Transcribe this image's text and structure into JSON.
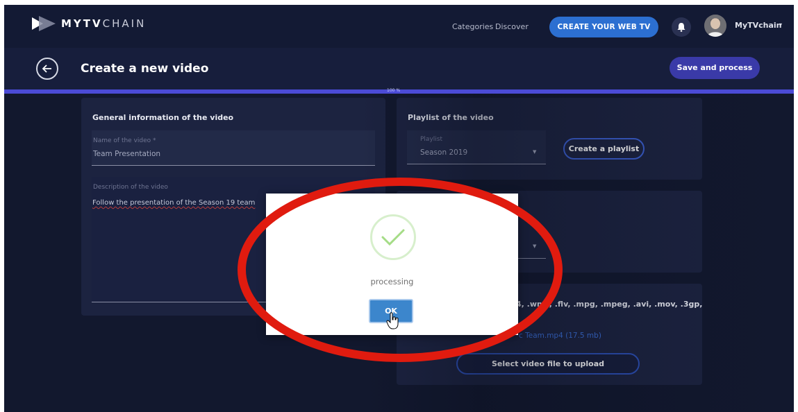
{
  "brand": {
    "logo_text_bold": "MYTV",
    "logo_text_light": "CHAIN"
  },
  "nav": {
    "categories": "Categories",
    "discover": "Discover",
    "create_web_tv": "CREATE YOUR WEB TV",
    "username": "MyTVchain",
    "user_caret": "▾"
  },
  "header": {
    "title": "Create a new video",
    "save_process": "Save and process",
    "progress_label": "100 %",
    "progress_value": 1.0
  },
  "general": {
    "title": "General information of the video",
    "name_label": "Name of the video *",
    "name_value": "Team Presentation",
    "description_label": "Description of the video",
    "description_value": "Follow the presentation of the Season 19 team"
  },
  "playlist": {
    "title": "Playlist of the video",
    "playlist_label": "Playlist",
    "playlist_value": "Season 2019",
    "create_playlist": "Create a playlist"
  },
  "upload": {
    "formats_text": "4, .wmv, .flv, .mpg, .mpeg, .avi, .mov, .3gp,",
    "file_text": "c Team.mp4 (17.5 mb)",
    "select_file": "Select video file to upload"
  },
  "dialog": {
    "message": "processing",
    "ok_label": "OK",
    "icon": "check-icon"
  },
  "colors": {
    "accent_blue": "#2c6fd1",
    "save_purple": "#3a3aa8",
    "annotation_red": "#e01b0f",
    "success_green": "#a5dc86"
  }
}
